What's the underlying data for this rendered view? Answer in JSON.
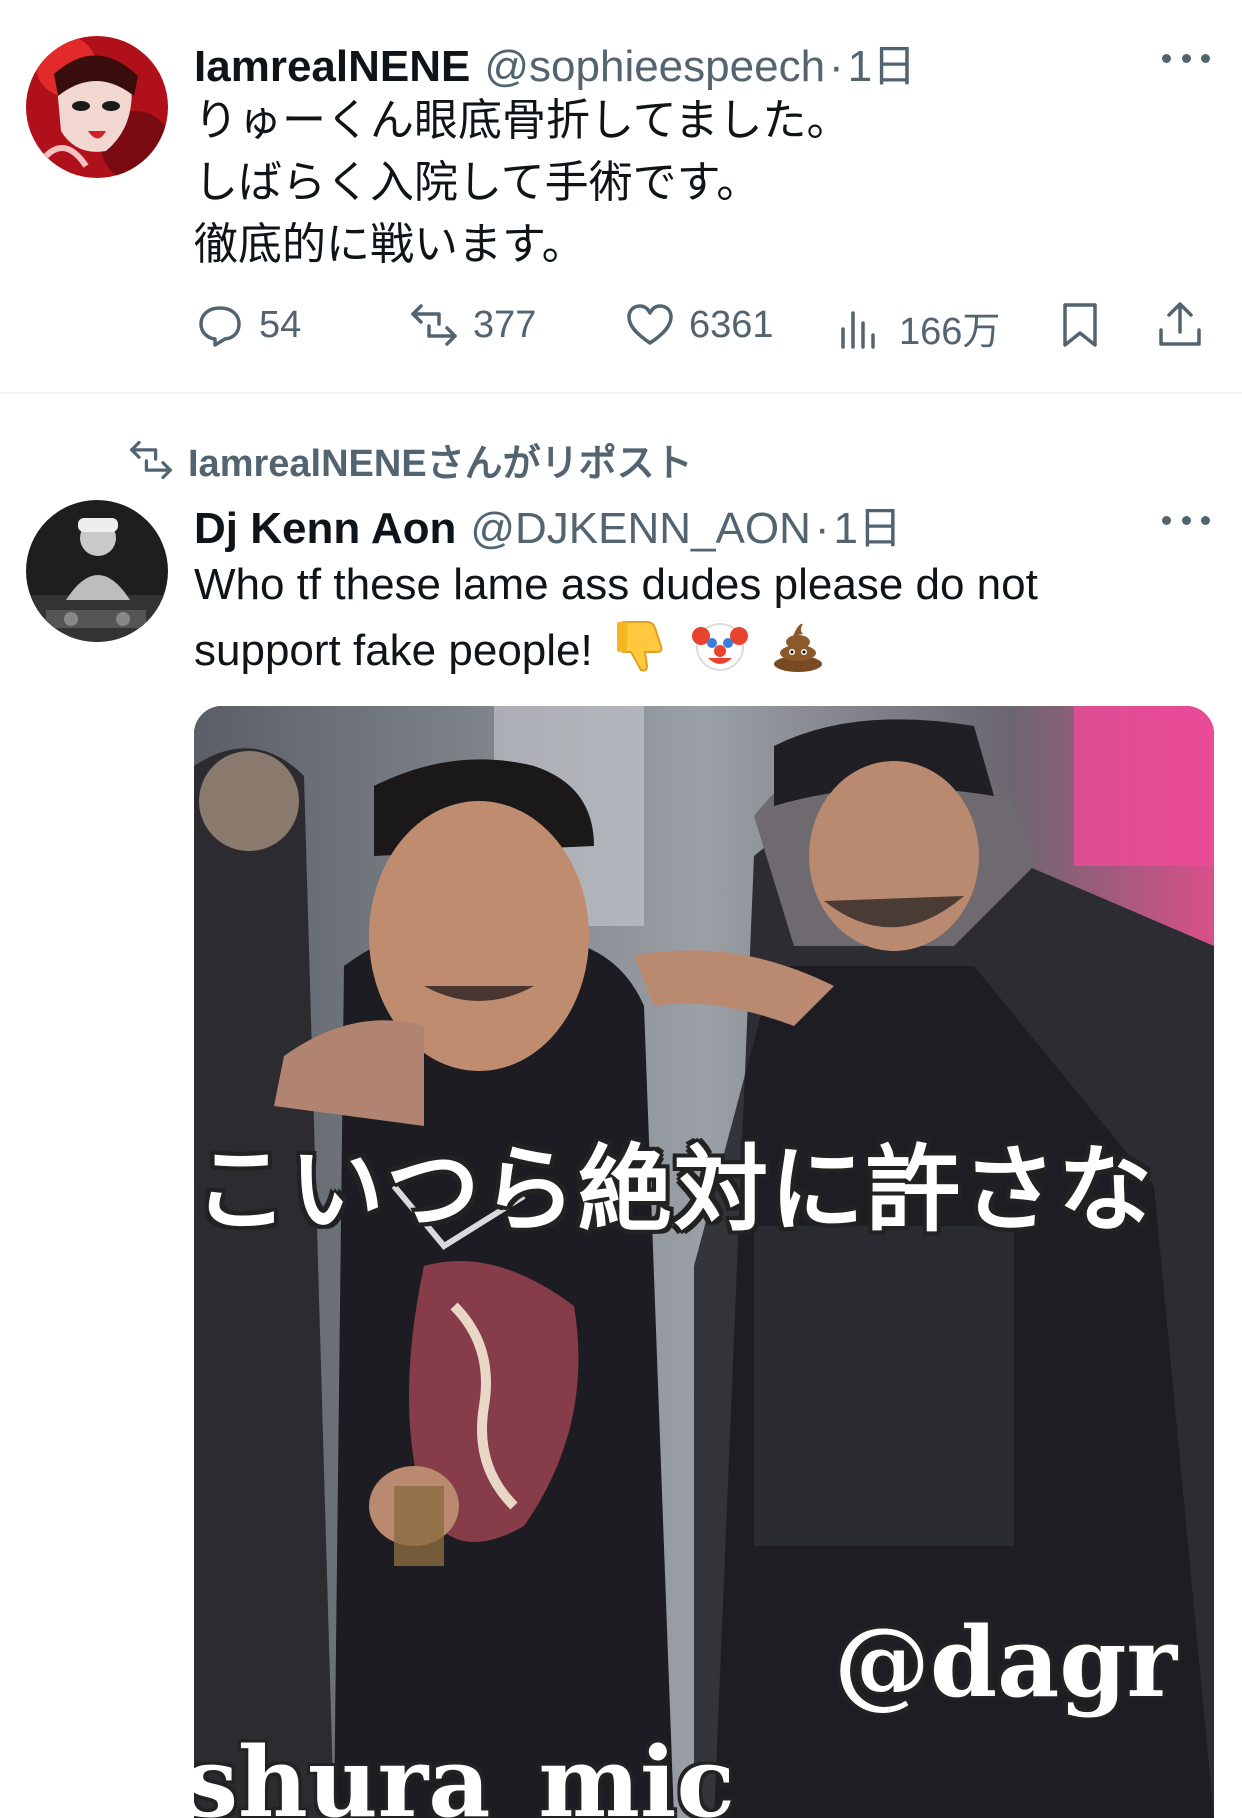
{
  "tweet1": {
    "display_name": "IamrealNENE",
    "handle": "@sophieespeech",
    "separator": "·",
    "time": "1日",
    "text": "りゅーくん眼底骨折してました。\nしばらく入院して手術です。\n徹底的に戦います。",
    "replies": "54",
    "reposts": "377",
    "likes": "6361",
    "views": "166万"
  },
  "repost_context": "IamrealNENEさんがリポスト",
  "tweet2": {
    "display_name": "Dj Kenn Aon",
    "handle": "@DJKENN_AON",
    "separator": "·",
    "time": "1日",
    "text_line1": "Who tf these lame ass dudes please do not",
    "text_line2": "support fake people!",
    "emojis": [
      "thumbs-down",
      "clown-face",
      "pile-of-poo"
    ],
    "photo_caption_jp": "こいつら絶対に許さな",
    "photo_tag_right": "@dagr",
    "photo_tag_left": "shura_mic"
  },
  "colors": {
    "secondary_text": "#536471",
    "divider": "#eff3f4"
  }
}
